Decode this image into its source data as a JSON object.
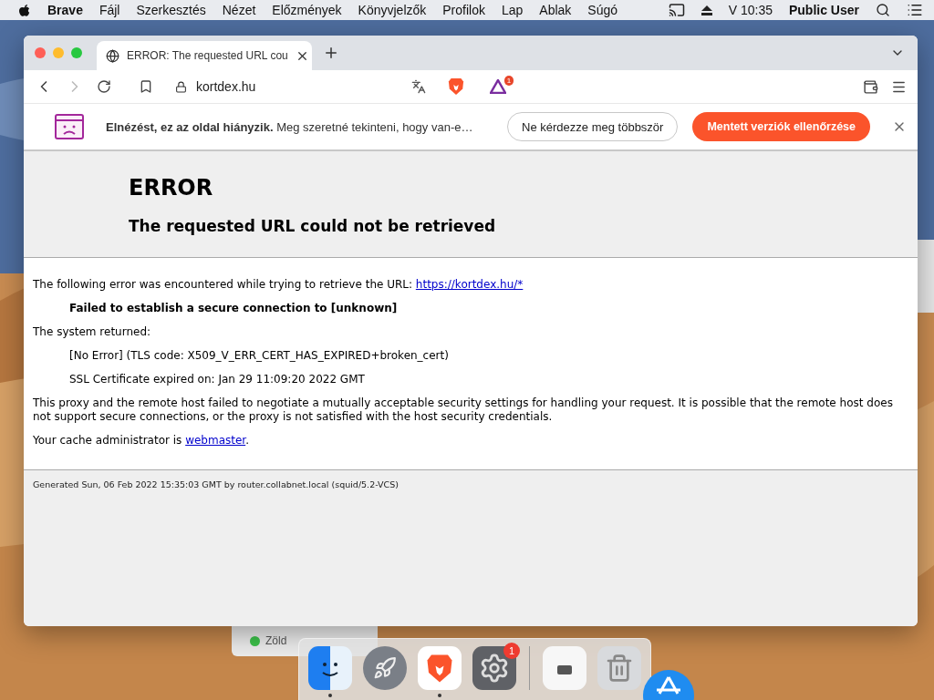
{
  "menu_bar": {
    "app": "Brave",
    "items": [
      "Fájl",
      "Szerkesztés",
      "Nézet",
      "Előzmények",
      "Könyvjelzők",
      "Profilok",
      "Lap",
      "Ablak",
      "Súgó"
    ],
    "time": "V 10:35",
    "user": "Public User"
  },
  "browser": {
    "tabs": [
      {
        "title": "ERROR: The requested URL cou",
        "selected": true
      }
    ],
    "address": "kortdex.hu",
    "rewards_badge": "1",
    "infobar": {
      "bold": "Elnézést, ez az oldal hiányzik.",
      "text": "Meg szeretné tekinteni, hogy van-e…",
      "secondary_button": "Ne kérdezze meg többször",
      "primary_button": "Mentett verziók ellenőrzése"
    },
    "page": {
      "title": "ERROR",
      "subtitle": "The requested URL could not be retrieved",
      "blocks": [
        {
          "kind": "para",
          "text": "The following error was encountered while trying to retrieve the URL: ",
          "link": "https://kortdex.hu/*"
        },
        {
          "kind": "strong",
          "text": "Failed to establish a secure connection to [unknown]"
        },
        {
          "kind": "para",
          "text": "The system returned:"
        },
        {
          "kind": "quote",
          "text": "[No Error] (TLS code: X509_V_ERR_CERT_HAS_EXPIRED+broken_cert)"
        },
        {
          "kind": "quote",
          "text": "SSL Certificate expired on: Jan 29 11:09:20 2022 GMT"
        },
        {
          "kind": "para",
          "text": "This proxy and the remote host failed to negotiate a mutually acceptable security settings for handling your request. It is possible that the remote host does not support secure connections, or the proxy is not satisfied with the host security credentials."
        },
        {
          "kind": "para",
          "text": "Your cache administrator is ",
          "link": "webmaster",
          "after": "."
        }
      ],
      "footer": "Generated Sun, 06 Feb 2022 15:35:03 GMT by router.collabnet.local (squid/5.2-VCS)"
    }
  },
  "background_window": {
    "label": "Zöld",
    "color": "#3cc24a"
  },
  "dock": {
    "items": [
      {
        "kind": "finder",
        "running": true
      },
      {
        "kind": "launchpad",
        "running": false
      },
      {
        "kind": "brave",
        "running": true
      },
      {
        "kind": "settings",
        "running": false,
        "badge": "1"
      },
      {
        "kind": "separator"
      },
      {
        "kind": "document",
        "running": false
      },
      {
        "kind": "trash",
        "running": false
      }
    ]
  }
}
